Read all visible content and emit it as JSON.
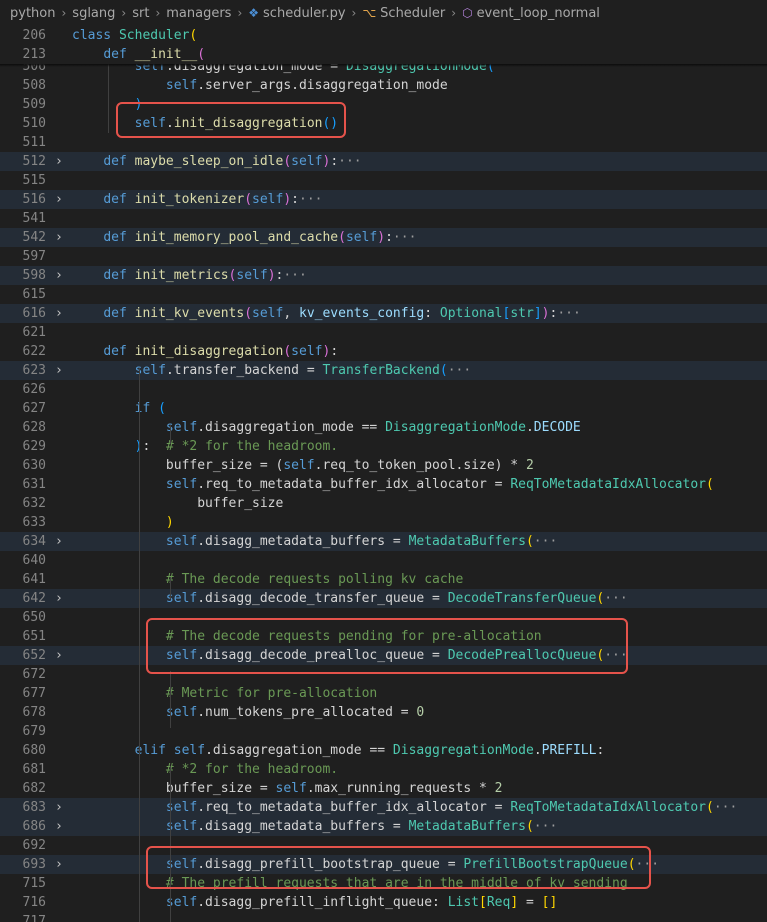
{
  "breadcrumb": [
    "python",
    "sglang",
    "srt",
    "managers",
    "scheduler.py",
    "Scheduler",
    "event_loop_normal"
  ],
  "lines": [
    {
      "n": "506",
      "t": [
        [
          "        ",
          ""
        ],
        [
          "self",
          "sf"
        ],
        [
          ".disaggregation_mode = ",
          ""
        ],
        [
          "DisaggregationMode",
          "cl"
        ],
        [
          "(",
          "p3"
        ]
      ]
    },
    {
      "n": "508",
      "t": [
        [
          "            ",
          ""
        ],
        [
          "self",
          "sf"
        ],
        [
          ".server_args.disaggregation_mode",
          ""
        ]
      ]
    },
    {
      "n": "509",
      "t": [
        [
          "        ",
          ""
        ],
        [
          ")",
          "p3"
        ]
      ]
    },
    {
      "n": "510",
      "t": [
        [
          "        ",
          ""
        ],
        [
          "self",
          "sf"
        ],
        [
          ".",
          ""
        ],
        [
          "init_disaggregation",
          "fn"
        ],
        [
          "()",
          "p3"
        ]
      ]
    },
    {
      "n": "511",
      "t": []
    },
    {
      "n": "512",
      "f": 1,
      "h": 1,
      "t": [
        [
          "    ",
          ""
        ],
        [
          "def ",
          "kw"
        ],
        [
          "maybe_sleep_on_idle",
          "fn"
        ],
        [
          "(",
          "p2"
        ],
        [
          "self",
          "sf"
        ],
        [
          ")",
          "p2"
        ],
        [
          ":",
          ""
        ],
        [
          "···",
          "el"
        ]
      ]
    },
    {
      "n": "515",
      "t": []
    },
    {
      "n": "516",
      "f": 1,
      "h": 1,
      "t": [
        [
          "    ",
          ""
        ],
        [
          "def ",
          "kw"
        ],
        [
          "init_tokenizer",
          "fn"
        ],
        [
          "(",
          "p2"
        ],
        [
          "self",
          "sf"
        ],
        [
          ")",
          "p2"
        ],
        [
          ":",
          ""
        ],
        [
          "···",
          "el"
        ]
      ]
    },
    {
      "n": "541",
      "t": []
    },
    {
      "n": "542",
      "f": 1,
      "h": 1,
      "t": [
        [
          "    ",
          ""
        ],
        [
          "def ",
          "kw"
        ],
        [
          "init_memory_pool_and_cache",
          "fn"
        ],
        [
          "(",
          "p2"
        ],
        [
          "self",
          "sf"
        ],
        [
          ")",
          "p2"
        ],
        [
          ":",
          ""
        ],
        [
          "···",
          "el"
        ]
      ]
    },
    {
      "n": "597",
      "t": []
    },
    {
      "n": "598",
      "f": 1,
      "h": 1,
      "t": [
        [
          "    ",
          ""
        ],
        [
          "def ",
          "kw"
        ],
        [
          "init_metrics",
          "fn"
        ],
        [
          "(",
          "p2"
        ],
        [
          "self",
          "sf"
        ],
        [
          ")",
          "p2"
        ],
        [
          ":",
          ""
        ],
        [
          "···",
          "el"
        ]
      ]
    },
    {
      "n": "615",
      "t": []
    },
    {
      "n": "616",
      "f": 1,
      "h": 1,
      "t": [
        [
          "    ",
          ""
        ],
        [
          "def ",
          "kw"
        ],
        [
          "init_kv_events",
          "fn"
        ],
        [
          "(",
          "p2"
        ],
        [
          "self",
          "sf"
        ],
        [
          ", ",
          ""
        ],
        [
          "kv_events_config",
          "pm"
        ],
        [
          ": ",
          ""
        ],
        [
          "Optional",
          "cl"
        ],
        [
          "[",
          "p3"
        ],
        [
          "str",
          "cl"
        ],
        [
          "]",
          "p3"
        ],
        [
          ")",
          "p2"
        ],
        [
          ":",
          ""
        ],
        [
          "···",
          "el"
        ]
      ]
    },
    {
      "n": "621",
      "t": []
    },
    {
      "n": "622",
      "t": [
        [
          "    ",
          ""
        ],
        [
          "def ",
          "kw"
        ],
        [
          "init_disaggregation",
          "fn"
        ],
        [
          "(",
          "p2"
        ],
        [
          "self",
          "sf"
        ],
        [
          ")",
          "p2"
        ],
        [
          ":",
          ""
        ]
      ]
    },
    {
      "n": "623",
      "f": 1,
      "h": 1,
      "t": [
        [
          "        ",
          ""
        ],
        [
          "self",
          "sf"
        ],
        [
          ".transfer_backend = ",
          ""
        ],
        [
          "TransferBackend",
          "cl"
        ],
        [
          "(",
          "p3"
        ],
        [
          "···",
          "el"
        ]
      ]
    },
    {
      "n": "626",
      "t": []
    },
    {
      "n": "627",
      "t": [
        [
          "        ",
          ""
        ],
        [
          "if ",
          "kw"
        ],
        [
          "(",
          "p3"
        ]
      ]
    },
    {
      "n": "628",
      "t": [
        [
          "            ",
          ""
        ],
        [
          "self",
          "sf"
        ],
        [
          ".disaggregation_mode == ",
          ""
        ],
        [
          "DisaggregationMode",
          "cl"
        ],
        [
          ".",
          ""
        ],
        [
          "DECODE",
          "pm"
        ]
      ]
    },
    {
      "n": "629",
      "t": [
        [
          "        ",
          ""
        ],
        [
          ")",
          "p3"
        ],
        [
          ":  ",
          ""
        ],
        [
          "# *2 for the headroom.",
          "cm"
        ]
      ]
    },
    {
      "n": "630",
      "t": [
        [
          "            ",
          ""
        ],
        [
          "buffer_size = (",
          ""
        ],
        [
          "self",
          "sf"
        ],
        [
          ".req_to_token_pool.size) * ",
          ""
        ],
        [
          "2",
          "nu"
        ]
      ]
    },
    {
      "n": "631",
      "t": [
        [
          "            ",
          ""
        ],
        [
          "self",
          "sf"
        ],
        [
          ".req_to_metadata_buffer_idx_allocator = ",
          ""
        ],
        [
          "ReqToMetadataIdxAllocator",
          "cl"
        ],
        [
          "(",
          "p1"
        ]
      ]
    },
    {
      "n": "632",
      "t": [
        [
          "                ",
          ""
        ],
        [
          "buffer_size",
          ""
        ]
      ]
    },
    {
      "n": "633",
      "t": [
        [
          "            ",
          ""
        ],
        [
          ")",
          "p1"
        ]
      ]
    },
    {
      "n": "634",
      "f": 1,
      "h": 1,
      "t": [
        [
          "            ",
          ""
        ],
        [
          "self",
          "sf"
        ],
        [
          ".disagg_metadata_buffers = ",
          ""
        ],
        [
          "MetadataBuffers",
          "cl"
        ],
        [
          "(",
          "p1"
        ],
        [
          "···",
          "el"
        ]
      ]
    },
    {
      "n": "640",
      "t": []
    },
    {
      "n": "641",
      "t": [
        [
          "            ",
          ""
        ],
        [
          "# The decode requests polling kv cache",
          "cm"
        ]
      ]
    },
    {
      "n": "642",
      "f": 1,
      "h": 1,
      "t": [
        [
          "            ",
          ""
        ],
        [
          "self",
          "sf"
        ],
        [
          ".disagg_decode_transfer_queue = ",
          ""
        ],
        [
          "DecodeTransferQueue",
          "cl"
        ],
        [
          "(",
          "p1"
        ],
        [
          "···",
          "el"
        ]
      ]
    },
    {
      "n": "650",
      "t": []
    },
    {
      "n": "651",
      "t": [
        [
          "            ",
          ""
        ],
        [
          "# The decode requests pending for pre-allocation",
          "cm"
        ]
      ]
    },
    {
      "n": "652",
      "f": 1,
      "h": 1,
      "t": [
        [
          "            ",
          ""
        ],
        [
          "self",
          "sf"
        ],
        [
          ".disagg_decode_prealloc_queue = ",
          ""
        ],
        [
          "DecodePreallocQueue",
          "cl"
        ],
        [
          "(",
          "p1"
        ],
        [
          "···",
          "el"
        ]
      ]
    },
    {
      "n": "672",
      "t": []
    },
    {
      "n": "677",
      "t": [
        [
          "            ",
          ""
        ],
        [
          "# Metric for pre-allocation",
          "cm"
        ]
      ]
    },
    {
      "n": "678",
      "t": [
        [
          "            ",
          ""
        ],
        [
          "self",
          "sf"
        ],
        [
          ".num_tokens_pre_allocated = ",
          ""
        ],
        [
          "0",
          "nu"
        ]
      ]
    },
    {
      "n": "679",
      "t": []
    },
    {
      "n": "680",
      "t": [
        [
          "        ",
          ""
        ],
        [
          "elif ",
          "kw"
        ],
        [
          "self",
          "sf"
        ],
        [
          ".disaggregation_mode == ",
          ""
        ],
        [
          "DisaggregationMode",
          "cl"
        ],
        [
          ".",
          ""
        ],
        [
          "PREFILL",
          "pm"
        ],
        [
          ":",
          ""
        ]
      ]
    },
    {
      "n": "681",
      "t": [
        [
          "            ",
          ""
        ],
        [
          "# *2 for the headroom.",
          "cm"
        ]
      ]
    },
    {
      "n": "682",
      "t": [
        [
          "            ",
          ""
        ],
        [
          "buffer_size = ",
          ""
        ],
        [
          "self",
          "sf"
        ],
        [
          ".max_running_requests * ",
          ""
        ],
        [
          "2",
          "nu"
        ]
      ]
    },
    {
      "n": "683",
      "f": 1,
      "h": 1,
      "t": [
        [
          "            ",
          ""
        ],
        [
          "self",
          "sf"
        ],
        [
          ".req_to_metadata_buffer_idx_allocator = ",
          ""
        ],
        [
          "ReqToMetadataIdxAllocator",
          "cl"
        ],
        [
          "(",
          "p1"
        ],
        [
          "···",
          "el"
        ]
      ]
    },
    {
      "n": "686",
      "f": 1,
      "h": 1,
      "t": [
        [
          "            ",
          ""
        ],
        [
          "self",
          "sf"
        ],
        [
          ".disagg_metadata_buffers = ",
          ""
        ],
        [
          "MetadataBuffers",
          "cl"
        ],
        [
          "(",
          "p1"
        ],
        [
          "···",
          "el"
        ]
      ]
    },
    {
      "n": "692",
      "t": []
    },
    {
      "n": "693",
      "f": 1,
      "h": 1,
      "t": [
        [
          "            ",
          ""
        ],
        [
          "self",
          "sf"
        ],
        [
          ".disagg_prefill_bootstrap_queue = ",
          ""
        ],
        [
          "PrefillBootstrapQueue",
          "cl"
        ],
        [
          "(",
          "p1"
        ],
        [
          "···",
          "el"
        ]
      ]
    },
    {
      "n": "715",
      "t": [
        [
          "            ",
          ""
        ],
        [
          "# The prefill requests that are in the middle of kv sending",
          "cm"
        ]
      ]
    },
    {
      "n": "716",
      "t": [
        [
          "            ",
          ""
        ],
        [
          "self",
          "sf"
        ],
        [
          ".disagg_prefill_inflight_queue: ",
          ""
        ],
        [
          "List",
          "cl"
        ],
        [
          "[",
          "p1"
        ],
        [
          "Req",
          "cl"
        ],
        [
          "]",
          "p1"
        ],
        [
          " = ",
          ""
        ],
        [
          "[]",
          "p1"
        ]
      ]
    },
    {
      "n": "717",
      "t": []
    }
  ],
  "sticky": [
    {
      "n": "206",
      "t": [
        [
          "class ",
          "kw"
        ],
        [
          "Scheduler",
          "cl"
        ],
        [
          "(",
          "p1"
        ]
      ]
    },
    {
      "n": "213",
      "t": [
        [
          "    ",
          ""
        ],
        [
          "def ",
          "kw"
        ],
        [
          "__init__",
          "fn"
        ],
        [
          "(",
          "p2"
        ]
      ]
    }
  ]
}
